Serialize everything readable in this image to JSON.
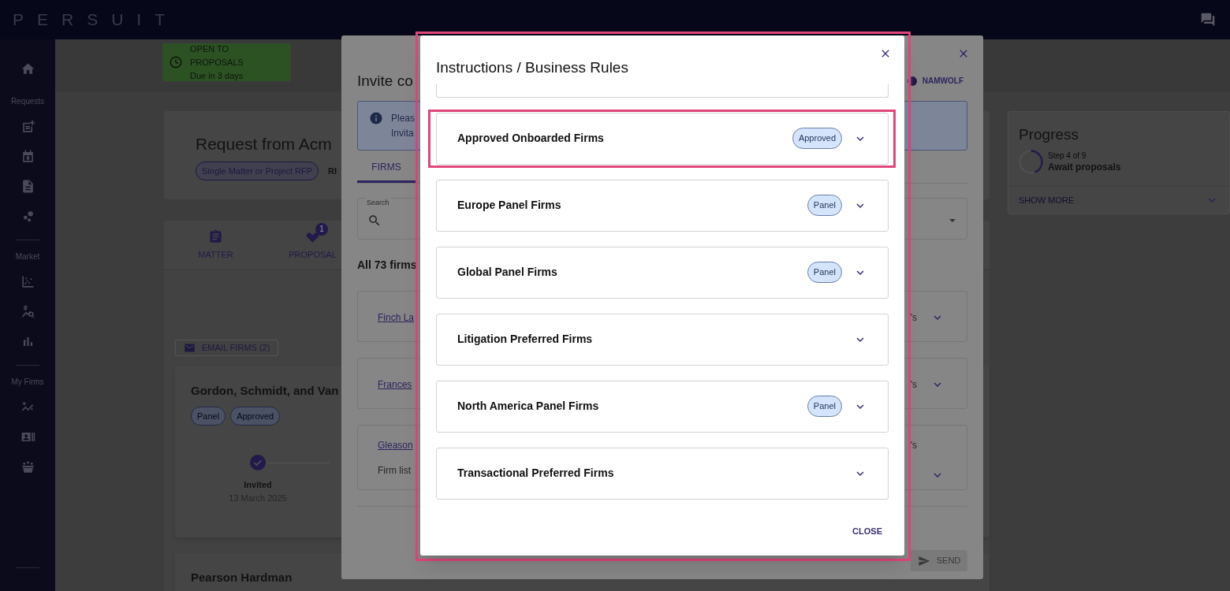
{
  "app": {
    "logo": "PERSUIT"
  },
  "sidebar": {
    "sections": [
      {
        "items": [
          {
            "kind": "home"
          }
        ]
      },
      {
        "label": "Requests",
        "items": [
          {
            "kind": "note-add"
          },
          {
            "kind": "calendar"
          },
          {
            "kind": "document"
          },
          {
            "kind": "bubbles"
          }
        ]
      },
      {
        "label": "Market",
        "items": [
          {
            "kind": "scatter"
          },
          {
            "kind": "dollar-search"
          },
          {
            "kind": "bars"
          }
        ]
      },
      {
        "label": "My Firms",
        "items": [
          {
            "kind": "trend"
          },
          {
            "kind": "contact"
          },
          {
            "kind": "team"
          }
        ]
      }
    ]
  },
  "status": {
    "title": "OPEN TO PROPOSALS",
    "due": "Due in 3 days"
  },
  "request": {
    "title": "Request from Acm",
    "chip": "Single Matter or Project RFP",
    "ref": "RI"
  },
  "nav_tabs": [
    {
      "label": "MATTER",
      "kind": "clipboard"
    },
    {
      "label": "PROPOSAL",
      "kind": "tag",
      "badge": "1"
    }
  ],
  "email_button": "EMAIL FIRMS (2)",
  "firm_cards": [
    {
      "name": "Gordon, Schmidt, and Van",
      "tags": [
        "Panel",
        "Approved"
      ],
      "step": {
        "label": "Invited",
        "date": "13 March 2025",
        "done": true
      }
    },
    {
      "name": "Pearson Hardman"
    }
  ],
  "progress": {
    "title": "Progress",
    "step": "Step 4 of 9",
    "stage": "Await proposals",
    "level": 0.44,
    "more": "SHOW MORE"
  },
  "invite_dialog": {
    "title": "Invite co",
    "badge": "NAMWOLF",
    "info": [
      "Pleas",
      "Invita"
    ],
    "tabs": [
      {
        "label": "FIRMS",
        "selected": true
      }
    ],
    "search_label": "Search",
    "count": "All 73 firms",
    "firms": [
      {
        "name": "Finch La",
        "tail": "'s"
      },
      {
        "name": "Frances",
        "tail": "'s"
      },
      {
        "name": "Gleason",
        "note": "Firm list",
        "tail": "'s"
      }
    ],
    "send": "SEND"
  },
  "rules_dialog": {
    "title": "Instructions / Business Rules",
    "highlighted": true,
    "groups": [
      {
        "name": "Approved Onboarded Firms",
        "tag": "Approved",
        "highlighted": true
      },
      {
        "name": "Europe Panel Firms",
        "tag": "Panel",
        "highlighted": false
      },
      {
        "name": "Global Panel Firms",
        "tag": "Panel",
        "highlighted": false
      },
      {
        "name": "Litigation Preferred Firms",
        "highlighted": false
      },
      {
        "name": "North America Panel Firms",
        "tag": "Panel",
        "highlighted": false
      },
      {
        "name": "Transactional Preferred Firms",
        "highlighted": false
      }
    ],
    "close": "CLOSE"
  }
}
